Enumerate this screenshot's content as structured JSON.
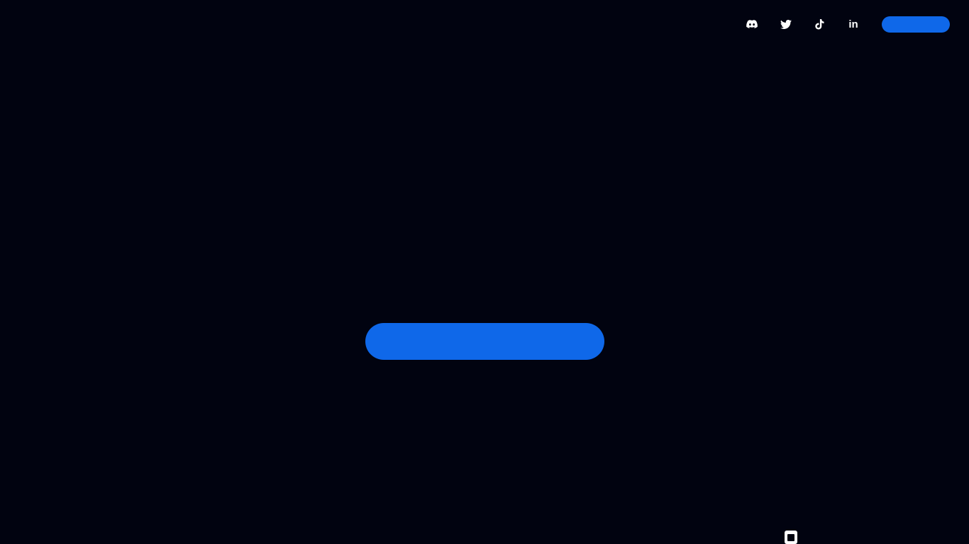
{
  "header": {
    "social_links": [
      {
        "name": "discord",
        "icon": "discord-icon"
      },
      {
        "name": "twitter",
        "icon": "twitter-icon"
      },
      {
        "name": "tiktok",
        "icon": "tiktok-icon"
      },
      {
        "name": "linkedin",
        "icon": "linkedin-icon",
        "glyph": "in"
      }
    ],
    "cta_label": ""
  },
  "hero": {
    "cta_label": ""
  },
  "corner_widget": {
    "icon": "square-icon"
  },
  "colors": {
    "background": "#010310",
    "accent": "#0f68e9",
    "icon": "#ffffff"
  }
}
